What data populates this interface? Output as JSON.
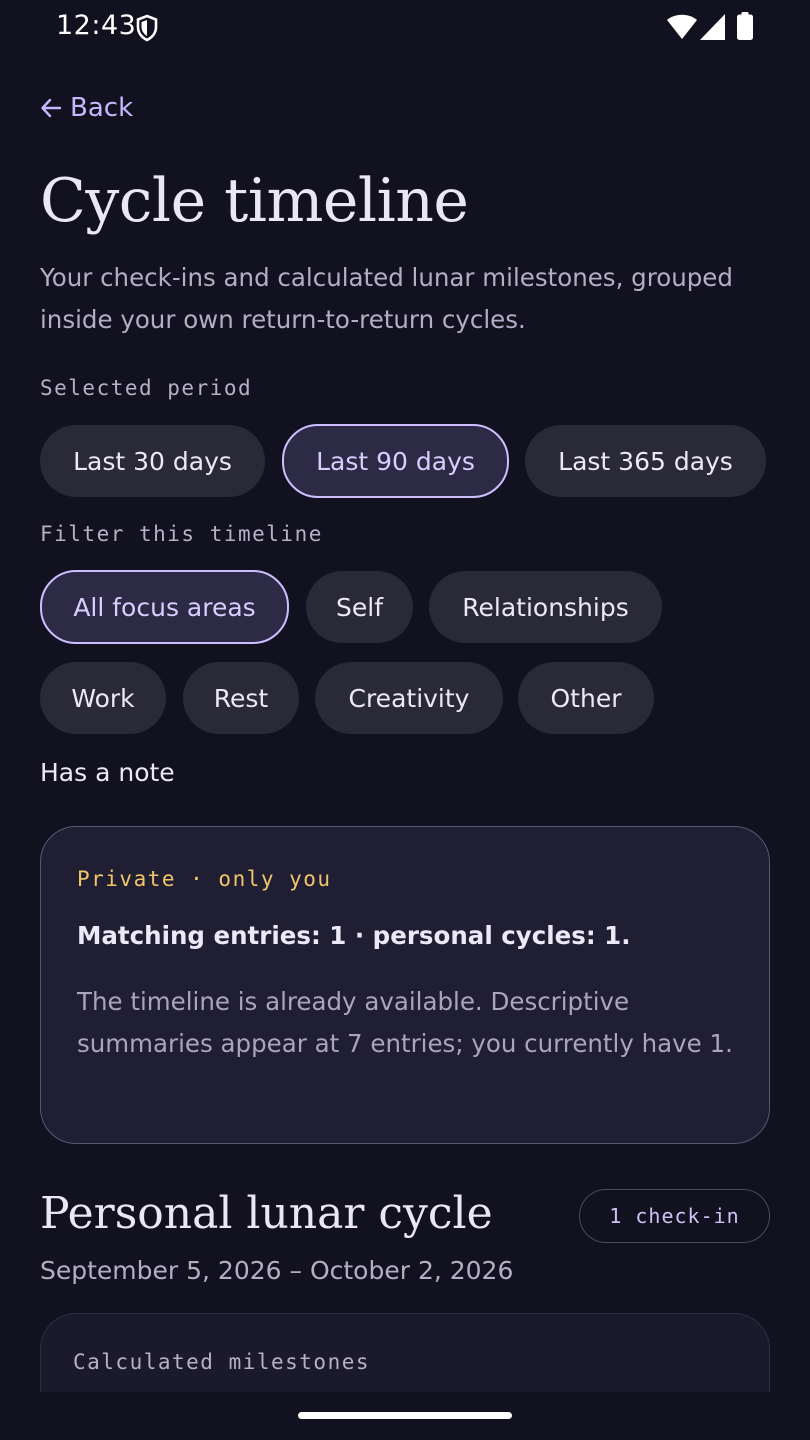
{
  "status_bar": {
    "time": "12:43",
    "icons": [
      "shield-icon",
      "wifi-icon",
      "signal-icon",
      "battery-icon"
    ]
  },
  "nav": {
    "back_label": "Back"
  },
  "header": {
    "title": "Cycle timeline",
    "subtitle": "Your check-ins and calculated lunar milestones, grouped inside your own return-to-return cycles."
  },
  "period": {
    "label": "Selected period",
    "options": [
      "Last 30 days",
      "Last 90 days",
      "Last 365 days"
    ],
    "selected": "Last 90 days"
  },
  "filter": {
    "label": "Filter this timeline",
    "options": [
      "All focus areas",
      "Self",
      "Relationships",
      "Work",
      "Rest",
      "Creativity",
      "Other"
    ],
    "selected": "All focus areas",
    "has_note_label": "Has a note"
  },
  "summary": {
    "privacy_label": "Private · only you",
    "count_text": "Matching entries: 1 · personal cycles: 1.",
    "description": "The timeline is already available. Descriptive summaries appear at 7 entries; you currently have 1."
  },
  "cycle": {
    "title": "Personal lunar cycle",
    "badge": "1 check-in",
    "dates": "September 5, 2026 – October 2, 2026",
    "milestones_label": "Calculated milestones"
  },
  "colors": {
    "background": "#12111f",
    "accent": "#cdbfff",
    "privacy": "#f0c56a",
    "chip": "#2a2937"
  }
}
